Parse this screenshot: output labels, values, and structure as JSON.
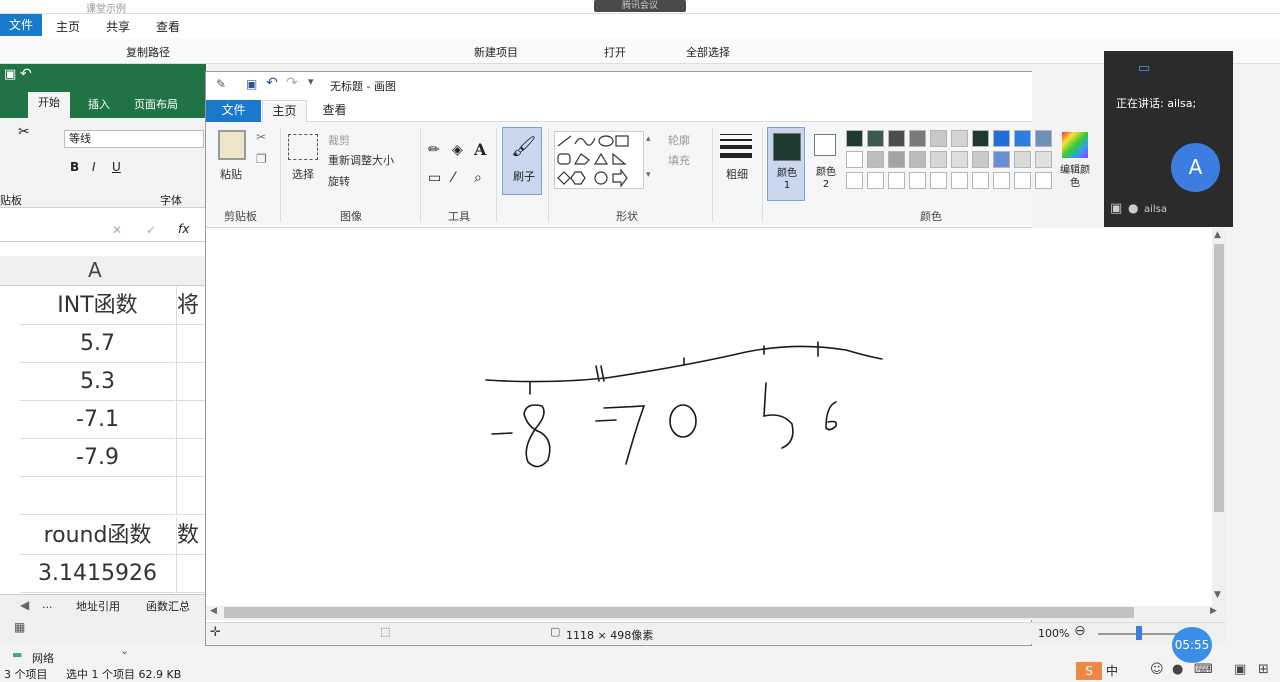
{
  "explorer": {
    "title": "课堂示例",
    "tabs": [
      "文件",
      "主页",
      "共享",
      "查看"
    ],
    "ribbon": [
      "复制路径",
      "新建项目",
      "打开",
      "全部选择"
    ],
    "status_items": "3 个项目",
    "status_selected": "选中 1 个项目  62.9 KB",
    "network": "网络"
  },
  "meeting": {
    "pill": "腾讯会议",
    "speaking": "正在讲话: ailsa;",
    "avatar_letter": "A",
    "user": "ailsa"
  },
  "excel": {
    "tabs": [
      "开始",
      "插入",
      "页面布局"
    ],
    "font": "等线",
    "group_font": "字体",
    "group_clip": "贴板",
    "col_header": "A",
    "rows": [
      "INT函数",
      "5.7",
      "5.3",
      "-7.1",
      "-7.9",
      "",
      "round函数",
      "3.1415926"
    ],
    "rowsB": [
      "将",
      "",
      "",
      "",
      "",
      "",
      "数",
      ""
    ],
    "sheets": [
      "...",
      "地址引用",
      "函数汇总"
    ]
  },
  "paint": {
    "title": "无标题 - 画图",
    "tabs": {
      "file": "文件",
      "home": "主页",
      "view": "查看"
    },
    "clipboard": {
      "paste": "粘贴",
      "group": "剪贴板"
    },
    "image": {
      "select": "选择",
      "crop": "裁剪",
      "resize": "重新调整大小",
      "rotate": "旋转",
      "group": "图像"
    },
    "tools": {
      "group": "工具"
    },
    "brush": "刷子",
    "shapes": {
      "outline": "轮廓",
      "fill": "填充",
      "group": "形状"
    },
    "size": "粗细",
    "colors": {
      "c1": "颜色 1",
      "c2": "颜色 2",
      "edit": "编辑颜色",
      "group": "颜色"
    },
    "status_size": "1118 × 498像素",
    "zoom": "100%",
    "drawing_text": [
      "-8",
      "-7",
      "0",
      "5",
      "6"
    ]
  },
  "taskbar": {
    "ime": "中",
    "time": "05:55"
  },
  "palette": [
    "#1f3a2e",
    "#3b5a4e",
    "#4c4c4c",
    "#7a7a7a",
    "#c8c8c8",
    "#d4d4d4",
    "#1c3a30",
    "#1f6fd6",
    "#2c7fe0",
    "#6e8fb8",
    "#ffffff",
    "#bdbdbd",
    "#a4a4a4",
    "#bbbbbb",
    "#d6d6d6",
    "#dddddd",
    "#c9c9c9",
    "#6a8ed4",
    "#dadada",
    "#e0e0e0"
  ]
}
